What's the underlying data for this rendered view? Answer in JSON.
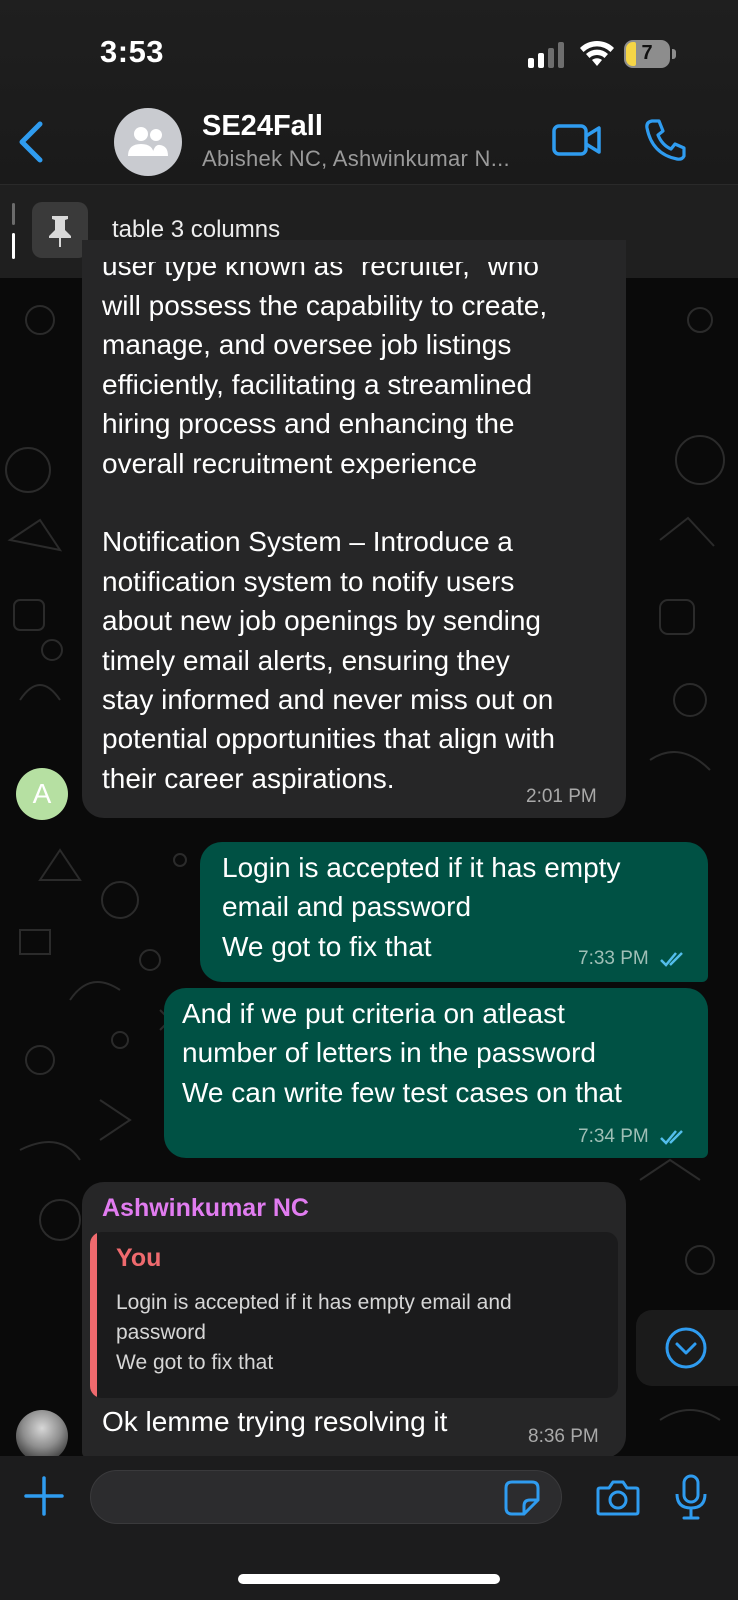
{
  "status_bar": {
    "time": "3:53",
    "battery": "7"
  },
  "header": {
    "title": "SE24Fall",
    "subtitle": "Abishek NC, Ashwinkumar N..."
  },
  "pinned": {
    "text": "table 3 columns"
  },
  "messages": [
    {
      "direction": "incoming",
      "partial_top_line": "user type known as \"recruiter,\" who",
      "text": "will possess the capability to create,\nmanage, and oversee job listings\nefficiently, facilitating a streamlined\nhiring process and enhancing the\noverall recruitment experience\n\nNotification System – Introduce a\nnotification system to notify users\nabout new job openings by sending\ntimely email alerts, ensuring they\nstay informed and never miss out on\npotential opportunities that align with\ntheir career aspirations.",
      "time": "2:01 PM",
      "avatar_letter": "A"
    },
    {
      "direction": "outgoing",
      "text": "Login is accepted if it has empty\nemail and password\nWe got to fix that",
      "time": "7:33 PM"
    },
    {
      "direction": "outgoing",
      "text": "And if we put criteria on atleast\nnumber of letters in the password\nWe can write few test cases on that",
      "time": "7:34 PM"
    },
    {
      "direction": "incoming",
      "sender": "Ashwinkumar NC",
      "quote": {
        "author": "You",
        "text": "Login is accepted if it has empty email and\npassword\nWe got to fix that"
      },
      "text": "Ok lemme trying resolving it",
      "time": "8:36 PM"
    }
  ],
  "colors": {
    "accent": "#2f9cf0",
    "outgoing_bubble": "#005144",
    "incoming_bubble": "#262627",
    "sender_name": "#e17cf0",
    "quote_author": "#ef6a6e",
    "read_ticks": "#53bdeb"
  },
  "icons": [
    "back-chevron-icon",
    "group-avatar-icon",
    "video-call-icon",
    "phone-icon",
    "pin-icon",
    "double-check-icon",
    "chevron-down-circle-icon",
    "plus-icon",
    "sticker-icon",
    "camera-icon",
    "microphone-icon"
  ]
}
